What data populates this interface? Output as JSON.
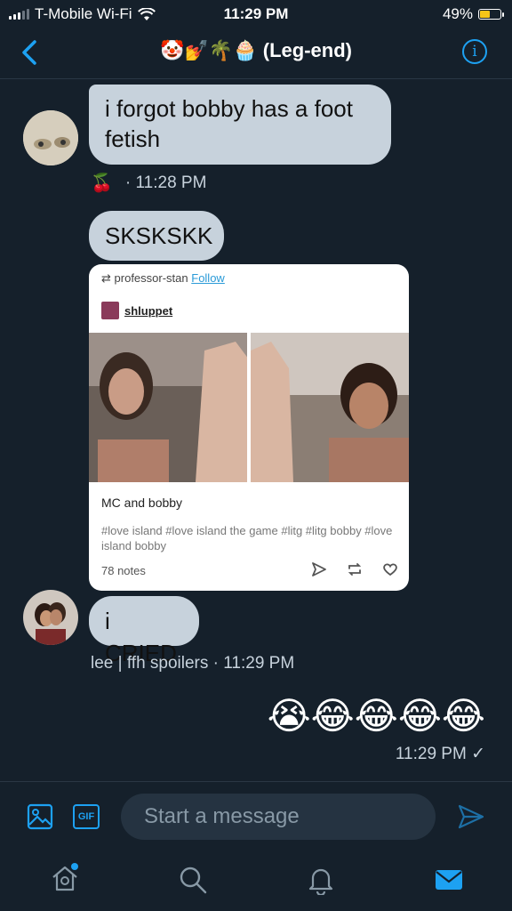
{
  "status_bar": {
    "carrier": "T-Mobile Wi-Fi",
    "time": "11:29 PM",
    "battery": "49%",
    "battery_level": 0.49
  },
  "header": {
    "title": "(Leg-end)",
    "title_emoji": "🤡💅🌴🧁",
    "info_glyph": "i"
  },
  "messages": {
    "m1": {
      "text": "i forgot bobby has a foot fetish",
      "reaction": "🍒",
      "time": "· 11:28 PM"
    },
    "m2": {
      "text": "SKSKSKK"
    },
    "post": {
      "reblogged_from": "professor-stan",
      "follow_label": "Follow",
      "username": "shluppet",
      "caption": "MC and bobby",
      "tags": "#love island  #love island the game  #litg  #litg bobby  #love island bobby",
      "notes": "78 notes"
    },
    "m3": {
      "text": "i CRIED",
      "sender_time": "lee | ffh spoilers · 11:29 PM"
    },
    "m4": {
      "emoji": "😭😂😂😂😂",
      "time": "11:29 PM ✓"
    }
  },
  "composer": {
    "placeholder": "Start a message",
    "gif_label": "GIF"
  },
  "colors": {
    "background": "#15202b",
    "accent": "#1da1f2",
    "incoming_bubble": "#c7d2dc"
  }
}
